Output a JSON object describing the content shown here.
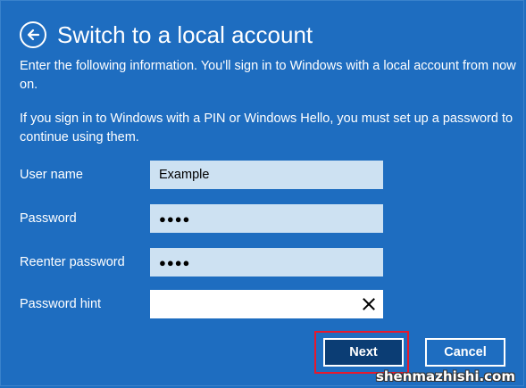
{
  "dialog": {
    "title": "Switch to a local account",
    "intro": "Enter the following information. You'll sign in to Windows with a local account from now on.",
    "pin_note": "If you sign in to Windows with a PIN or Windows Hello, you must set up a password to continue using them."
  },
  "form": {
    "username": {
      "label": "User name",
      "value": "Example"
    },
    "password": {
      "label": "Password",
      "masked_value": "●●●●"
    },
    "reenter": {
      "label": "Reenter password",
      "masked_value": "●●●●"
    },
    "hint": {
      "label": "Password hint",
      "value": ""
    }
  },
  "buttons": {
    "next": "Next",
    "cancel": "Cancel"
  },
  "watermark": "shenmazhishi.com",
  "colors": {
    "background": "#1e6dc0",
    "field": "#cde1f2",
    "next_button": "#0b3d74",
    "highlight": "#e8192c"
  },
  "icons": {
    "back": "back-arrow-circle-icon",
    "clear": "close-icon"
  }
}
